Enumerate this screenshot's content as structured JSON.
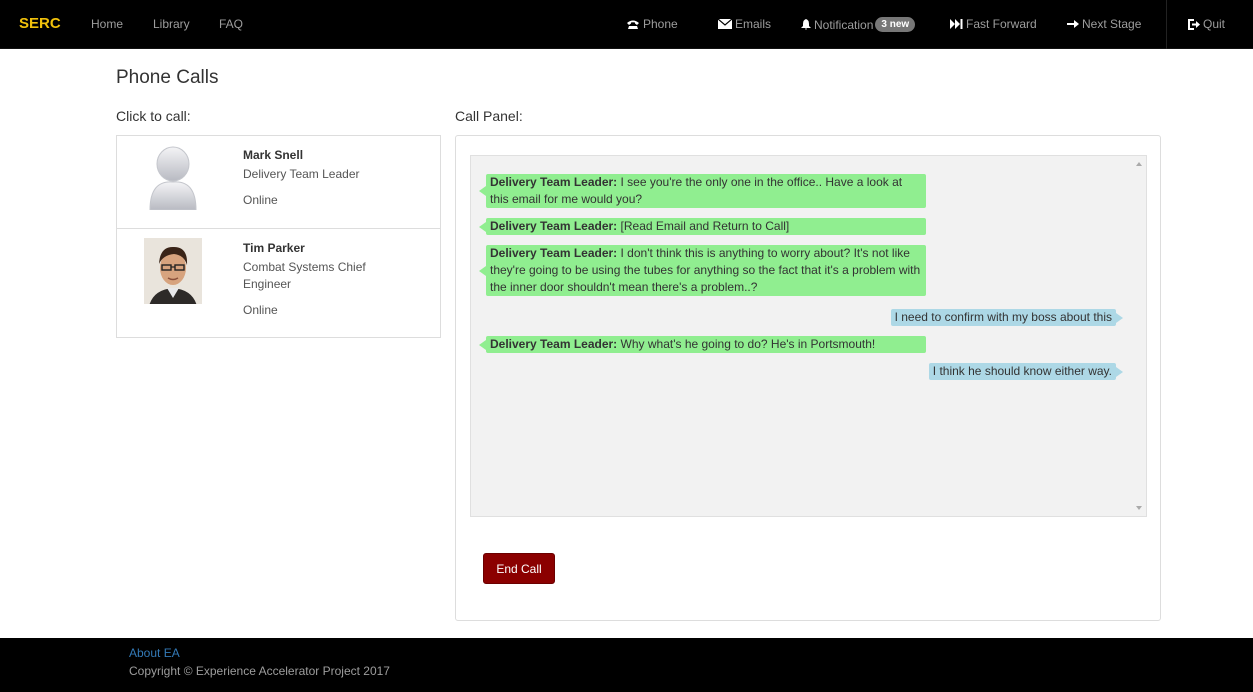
{
  "navbar": {
    "brand": "SERC",
    "left_links": [
      "Home",
      "Library",
      "FAQ"
    ],
    "phone": "Phone",
    "emails": "Emails",
    "notification": "Notification",
    "notification_badge": "3 new",
    "fast_forward": "Fast Forward",
    "next_stage": "Next Stage",
    "quit": "Quit"
  },
  "page": {
    "title": "Phone Calls",
    "click_to_call": "Click to call:",
    "call_panel": "Call Panel:"
  },
  "contacts": [
    {
      "name": "Mark Snell",
      "role": "Delivery Team Leader",
      "status": "Online"
    },
    {
      "name": "Tim Parker",
      "role": "Combat Systems Chief Engineer",
      "status": "Online"
    }
  ],
  "messages": [
    {
      "sender": "Delivery Team Leader:",
      "text": "I see you're the only one in the office.. Have a look at this email for me would you?"
    },
    {
      "sender": "Delivery Team Leader:",
      "text": "[Read Email and Return to Call]"
    },
    {
      "sender": "Delivery Team Leader:",
      "text": "I don't think this is anything to worry about? It's not like they're going to be using the tubes for anything so the fact that it's a problem with the inner door shouldn't mean there's a problem..?"
    },
    {
      "text": "I need to confirm with my boss about this"
    },
    {
      "sender": "Delivery Team Leader:",
      "text": "Why what's he going to do? He's in Portsmouth!"
    },
    {
      "text": "I think he should know either way."
    }
  ],
  "end_call_label": "End Call",
  "footer": {
    "about": "About EA",
    "copyright": "Copyright © Experience Accelerator Project 2017"
  },
  "colors": {
    "brand": "#f0c10b",
    "incoming_bubble": "#90ee90",
    "outgoing_bubble": "#add8e6",
    "end_call": "#8b0000"
  }
}
